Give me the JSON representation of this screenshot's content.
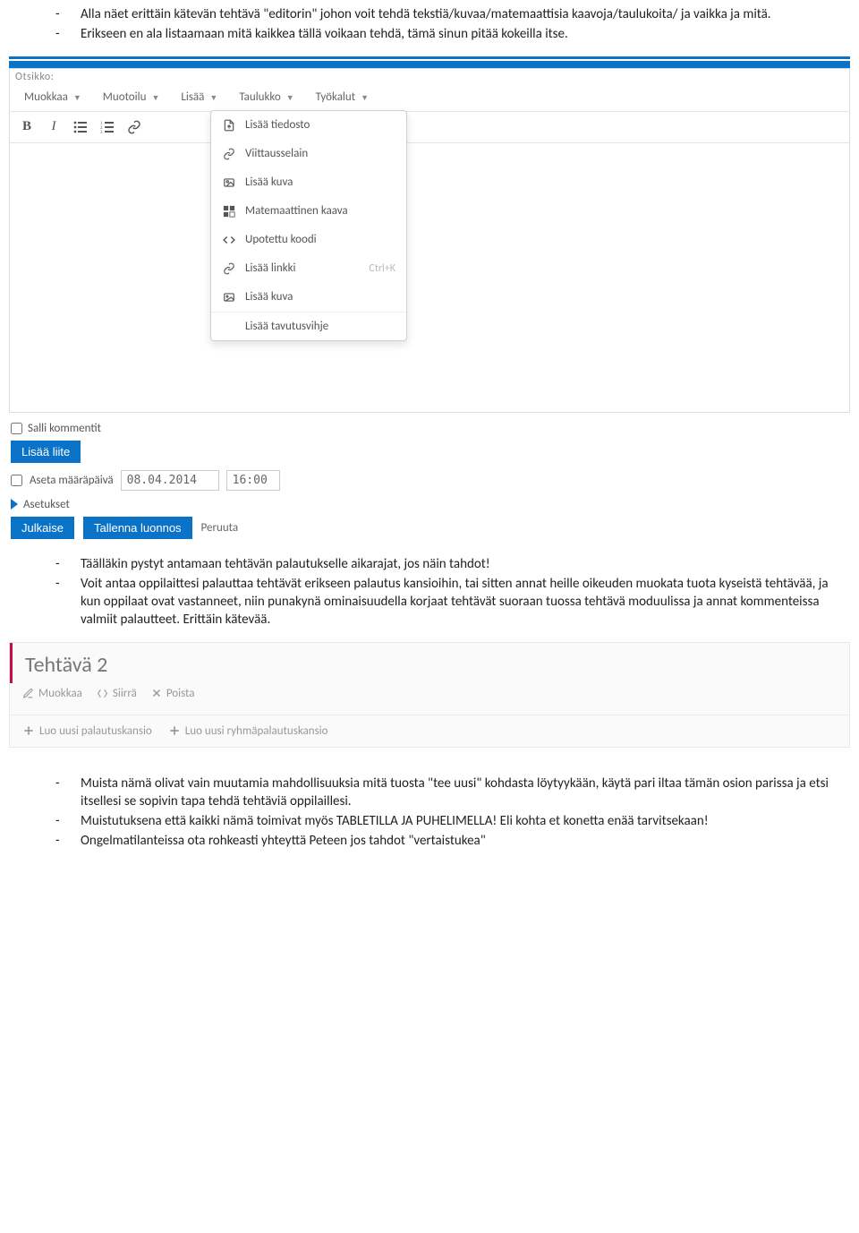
{
  "intro": {
    "items": [
      "Alla näet erittäin kätevän tehtävä \"editorin\" johon voit tehdä tekstiä/kuvaa/matemaattisia kaavoja/taulukoita/ ja vaikka ja mitä.",
      "Erikseen en ala listaamaan mitä kaikkea tällä voikaan tehdä, tämä sinun pitää kokeilla itse."
    ]
  },
  "editor": {
    "top_label": "Otsikko:",
    "menu": [
      "Muokkaa",
      "Muotoilu",
      "Lisää",
      "Taulukko",
      "Työkalut"
    ],
    "dropdown": [
      {
        "label": "Lisää tiedosto"
      },
      {
        "label": "Viittausselain"
      },
      {
        "label": "Lisää kuva"
      },
      {
        "label": "Matemaattinen kaava"
      },
      {
        "label": "Upotettu koodi"
      },
      {
        "label": "Lisää linkki",
        "shortcut": "Ctrl+K"
      },
      {
        "label": "Lisää kuva"
      }
    ],
    "dropdown_footer": "Lisää tavutusvihje",
    "allow_comments": "Salli kommentit",
    "add_attachment": "Lisää liite",
    "set_deadline": "Aseta määräpäivä",
    "date_value": "08.04.2014",
    "time_value": "16:00",
    "settings": "Asetukset",
    "publish": "Julkaise",
    "save_draft": "Tallenna luonnos",
    "cancel": "Peruuta"
  },
  "mid_notes": {
    "items": [
      "Täälläkin pystyt antamaan tehtävän palautukselle aikarajat, jos näin tahdot!",
      "Voit antaa oppilaittesi palauttaa tehtävät erikseen palautus kansioihin, tai sitten annat heille oikeuden muokata tuota kyseistä tehtävää, ja kun oppilaat ovat vastanneet, niin punakynä ominaisuudella korjaat tehtävät suoraan tuossa tehtävä moduulissa ja annat kommenteissa valmiit palautteet. Erittäin kätevää."
    ]
  },
  "panel": {
    "title": "Tehtävä 2",
    "tools": {
      "edit": "Muokkaa",
      "move": "Siirrä",
      "delete": "Poista"
    },
    "sub": {
      "new_folder": "Luo uusi palautuskansio",
      "new_group_folder": "Luo uusi ryhmäpalautuskansio"
    }
  },
  "outro": {
    "items": [
      "Muista nämä olivat vain muutamia mahdollisuuksia mitä tuosta \"tee uusi\" kohdasta löytyykään, käytä pari iltaa tämän osion parissa ja etsi itsellesi se sopivin tapa tehdä tehtäviä oppilaillesi.",
      "Muistutuksena että kaikki nämä toimivat myös TABLETILLA JA PUHELIMELLA! Eli kohta et konetta enää tarvitsekaan!",
      "Ongelmatilanteissa ota rohkeasti yhteyttä Peteen jos tahdot \"vertaistukea\""
    ]
  }
}
